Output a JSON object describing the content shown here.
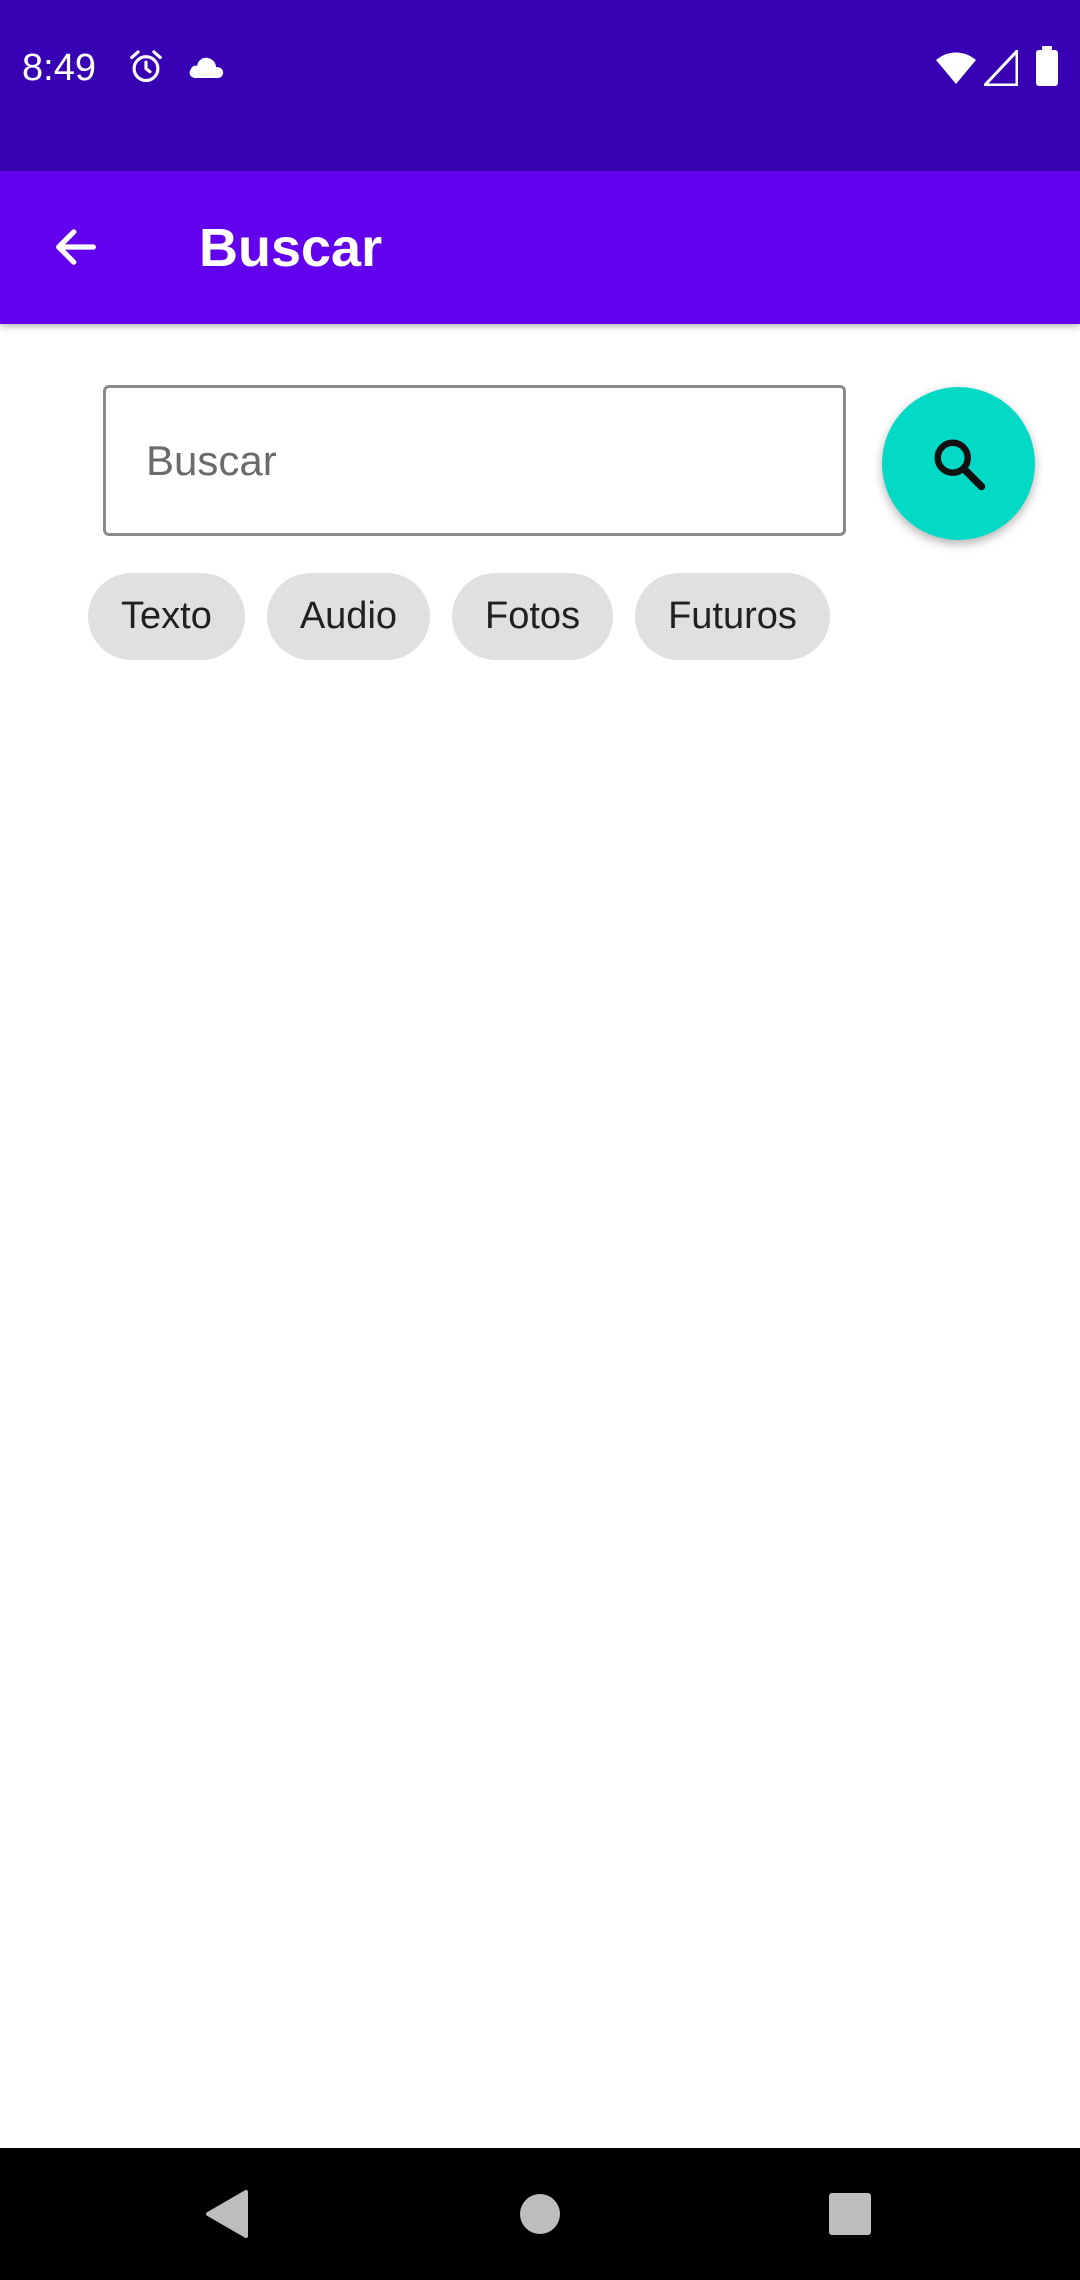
{
  "status_bar": {
    "time": "8:49",
    "icons": [
      "alarm-icon",
      "cloud-icon",
      "wifi-icon",
      "cell-signal-icon",
      "battery-icon"
    ]
  },
  "app_bar": {
    "title": "Buscar",
    "back_icon": "arrow-back-icon"
  },
  "search": {
    "placeholder": "Buscar",
    "value": "",
    "fab_icon": "search-icon"
  },
  "chips": [
    {
      "label": "Texto"
    },
    {
      "label": "Audio"
    },
    {
      "label": "Fotos"
    },
    {
      "label": "Futuros"
    }
  ],
  "nav_bar": {
    "buttons": [
      "back-triangle-icon",
      "home-circle-icon",
      "recents-square-icon"
    ]
  },
  "colors": {
    "status_bar": "#3700b3",
    "app_bar": "#6200ee",
    "fab": "#03dac5",
    "chip": "#e0e0e0"
  }
}
